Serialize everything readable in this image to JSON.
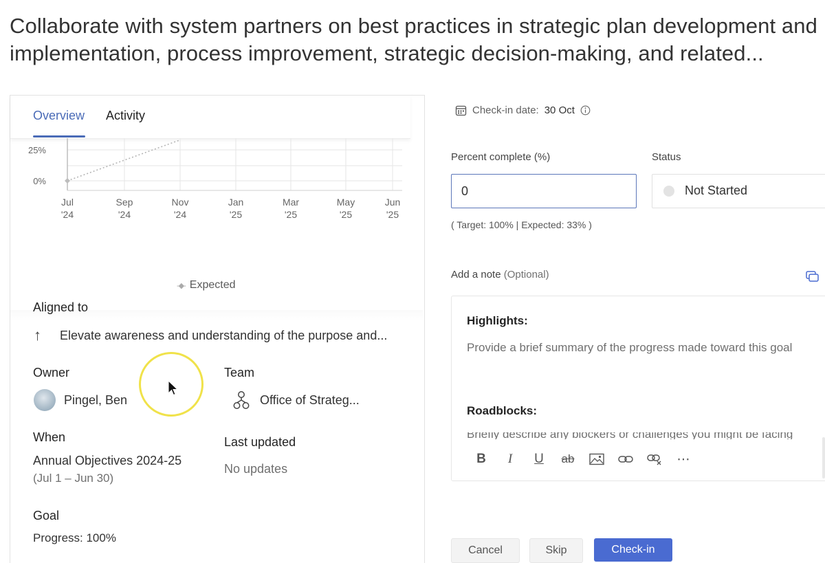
{
  "title": "Collaborate with system partners on best practices in strategic plan development and implementation, process improvement, strategic decision-making, and related...",
  "tabs": [
    {
      "label": "Overview",
      "active": true
    },
    {
      "label": "Activity",
      "active": false
    }
  ],
  "chart_data": {
    "type": "line",
    "x": [
      "Jul '24",
      "Sep '24",
      "Nov '24",
      "Jan '25",
      "Mar '25",
      "May '25",
      "Jun '25"
    ],
    "y_ticks": [
      "25%",
      "0%"
    ],
    "series": [
      {
        "name": "Expected",
        "style": "dotted",
        "points": [
          [
            "Jul '24",
            0
          ],
          [
            "Nov '24",
            33
          ]
        ]
      }
    ],
    "ylim_visible": [
      0,
      25
    ],
    "grid": true,
    "legend": "bottom-center"
  },
  "aligned": {
    "label": "Aligned to",
    "value": "Elevate awareness and understanding of the purpose and..."
  },
  "owner": {
    "label": "Owner",
    "name": "Pingel, Ben"
  },
  "team": {
    "label": "Team",
    "name": "Office of Strateg..."
  },
  "when": {
    "label": "When",
    "value": "Annual Objectives 2024-25",
    "range": "(Jul 1 – Jun 30)"
  },
  "last_updated": {
    "label": "Last updated",
    "value": "No updates"
  },
  "goal": {
    "label": "Goal",
    "progress": "Progress: 100%"
  },
  "checkin": {
    "label": "Check-in date:",
    "date": "30 Oct"
  },
  "percent": {
    "label": "Percent complete (%)",
    "value": "0"
  },
  "status": {
    "label": "Status",
    "value": "Not Started"
  },
  "target_line": "( Target: 100% | Expected: 33% )",
  "note": {
    "label": "Add a note",
    "optional": "(Optional)",
    "highlights_heading": "Highlights:",
    "highlights_placeholder": "Provide a brief summary of the progress made toward this goal",
    "roadblocks_heading": "Roadblocks:",
    "roadblocks_placeholder": "Briefly describe any blockers or challenges you might be facing"
  },
  "toolbar": [
    "B",
    "I",
    "U",
    "ab",
    "image",
    "link",
    "unlink",
    "⋯"
  ],
  "buttons": {
    "cancel": "Cancel",
    "skip": "Skip",
    "checkin": "Check-in"
  },
  "colors": {
    "accent": "#4a6bb7",
    "primary_button": "#4a6bd1",
    "cursor_highlight": "#f0e24a"
  }
}
